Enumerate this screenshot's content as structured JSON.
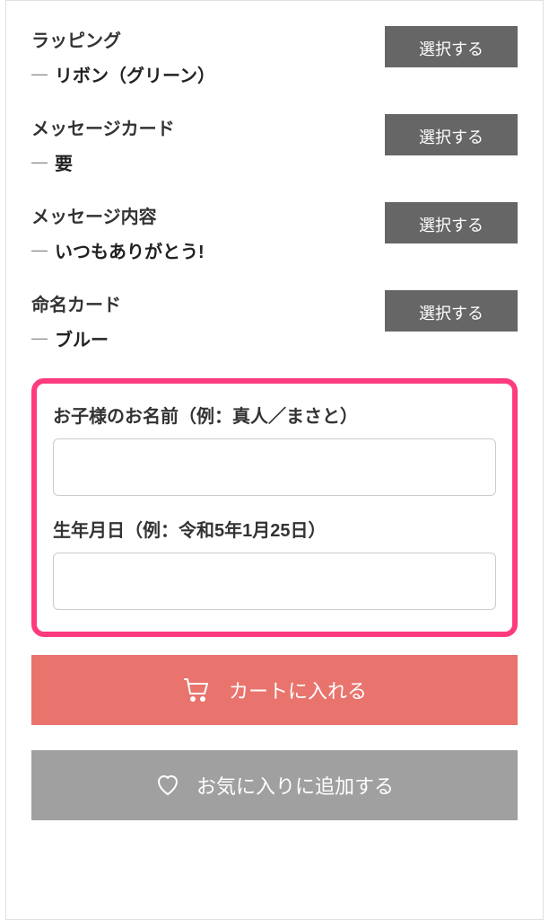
{
  "options": [
    {
      "title": "ラッピング",
      "value": "リボン（グリーン）",
      "button": "選択する"
    },
    {
      "title": "メッセージカード",
      "value": "要",
      "button": "選択する"
    },
    {
      "title": "メッセージ内容",
      "value": "いつもありがとう!",
      "button": "選択する"
    },
    {
      "title": "命名カード",
      "value": "ブルー",
      "button": "選択する"
    }
  ],
  "nameField": {
    "label": "お子様のお名前（例：真人／まさと）",
    "value": ""
  },
  "birthdateField": {
    "label": "生年月日（例：令和5年1月25日）",
    "value": ""
  },
  "cartButton": "カートに入れる",
  "favoriteButton": "お気に入りに追加する"
}
